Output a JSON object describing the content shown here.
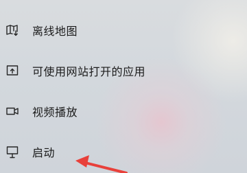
{
  "settings_menu": {
    "items": [
      {
        "label": "离线地图",
        "icon": "offline-map-icon"
      },
      {
        "label": "可使用网站打开的应用",
        "icon": "apps-for-websites-icon"
      },
      {
        "label": "视频播放",
        "icon": "video-playback-icon"
      },
      {
        "label": "启动",
        "icon": "startup-icon"
      }
    ]
  },
  "annotation": {
    "arrow_color": "#e8403a"
  }
}
